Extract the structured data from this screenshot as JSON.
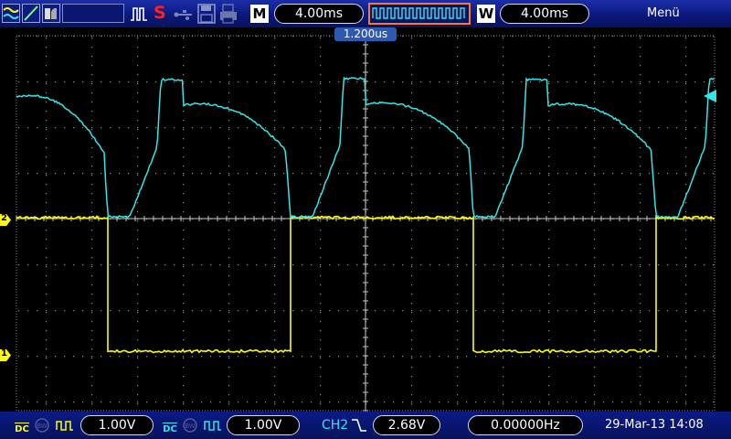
{
  "toolbar": {
    "timebase_label": "M",
    "timebase_value": "4.00ms",
    "window_label": "W",
    "window_value": "4.00ms",
    "menu_label": "Menü",
    "stop_indicator": "S"
  },
  "trigger": {
    "position_label": "1.200us"
  },
  "bottom": {
    "ch1_coupling": "DC",
    "ch1_scale": "1.00V",
    "ch2_coupling": "DC",
    "ch2_scale": "1.00V",
    "trigger_source": "CH2",
    "trigger_level": "2.68V",
    "frequency": "0.00000Hz",
    "datetime": "29-Mar-13 14:08"
  },
  "markers": {
    "ch1": "1",
    "ch2": "2"
  },
  "colors": {
    "ch1": "#ffff00",
    "ch2": "#33e6e6",
    "grid": "#8a8a8a",
    "trigger_accent": "#ff7a1a"
  }
}
